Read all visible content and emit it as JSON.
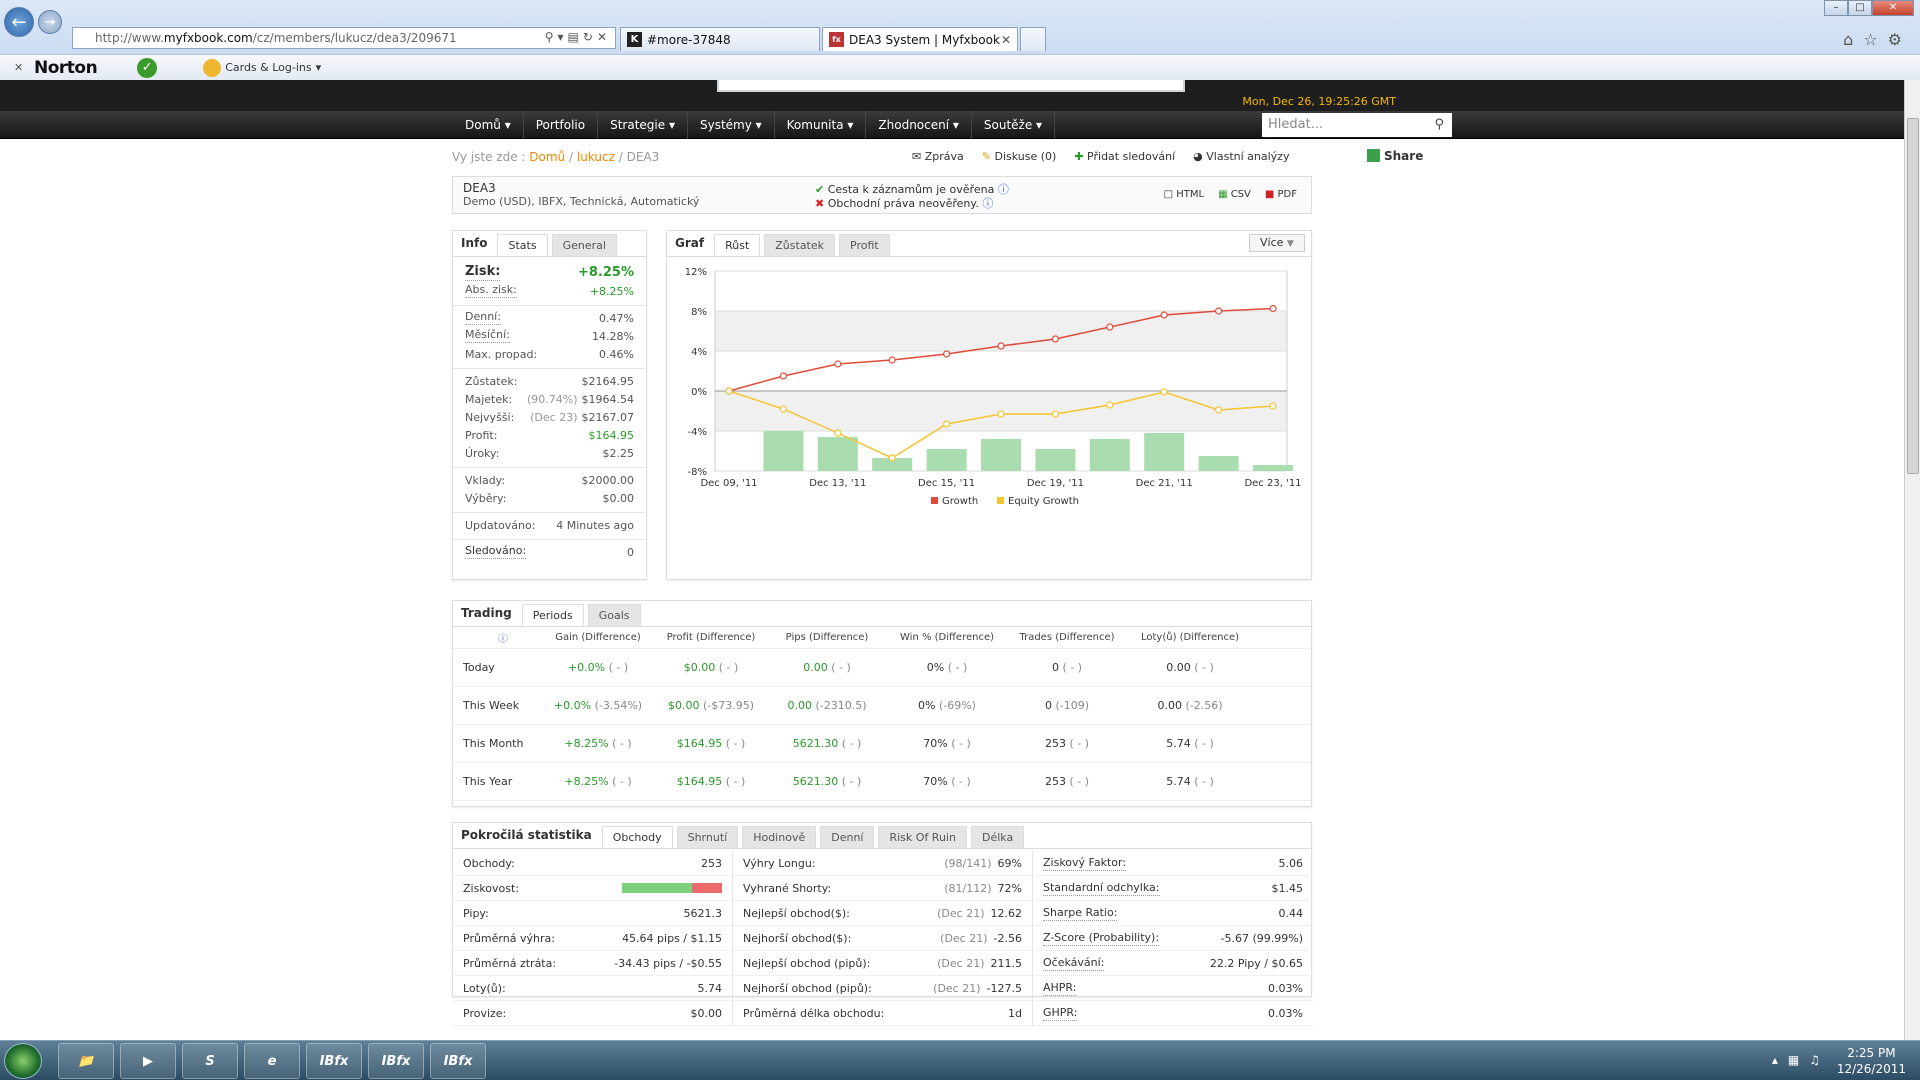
{
  "browser": {
    "url_prefix": "http://www.",
    "url_domain": "myfxbook.com",
    "url_path": "/cz/members/lukucz/dea3/209671",
    "tabs": [
      {
        "label": "#more-37848",
        "icon": "K"
      },
      {
        "label": "DEA3 System | Myfxbook",
        "icon": "fx"
      }
    ],
    "norton": "Norton",
    "cards": "Cards & Log-ins"
  },
  "site": {
    "date": "Mon, Dec 26, 19:25:26 GMT",
    "menu": [
      "Domů ▾",
      "Portfolio",
      "Strategie ▾",
      "Systémy ▾",
      "Komunita ▾",
      "Zhodnocení ▾",
      "Soutěže ▾"
    ],
    "search_placeholder": "Hledat..."
  },
  "breadcrumb": {
    "prefix": "Vy jste zde :",
    "home": "Domů",
    "sep": "/",
    "user": "lukucz",
    "current": "DEA3"
  },
  "actions": {
    "message": "Zpráva",
    "discussion": "Diskuse (0)",
    "follow": "Přidat sledování",
    "analysis": "Vlastní analýzy",
    "share": "Share"
  },
  "system": {
    "name": "DEA3",
    "subtitle": "Demo (USD), IBFX, Technická, Automatický",
    "verified_track": "Cesta k záznamům je ověřena",
    "unverified_privileges": "Obchodní práva neověřeny.",
    "exports": [
      "HTML",
      "CSV",
      "PDF"
    ]
  },
  "info": {
    "tabs": [
      "Info",
      "Stats",
      "General"
    ],
    "gain_label": "Zisk:",
    "gain": "+8.25%",
    "abs_gain_label": "Abs. zisk:",
    "abs_gain": "+8.25%",
    "daily_label": "Denní:",
    "daily": "0.47%",
    "monthly_label": "Měsíční:",
    "monthly": "14.28%",
    "drawdown_label": "Max. propad:",
    "drawdown": "0.46%",
    "balance_label": "Zůstatek:",
    "balance": "$2164.95",
    "equity_label": "Majetek:",
    "equity_pct": "(90.74%)",
    "equity": "$1964.54",
    "highest_label": "Nejvyšší:",
    "highest_date": "(Dec 23)",
    "highest": "$2167.07",
    "profit_label": "Profit:",
    "profit": "$164.95",
    "interest_label": "Úroky:",
    "interest": "$2.25",
    "deposits_label": "Vklady:",
    "deposits": "$2000.00",
    "withdrawals_label": "Výběry:",
    "withdrawals": "$0.00",
    "updated_label": "Updatováno:",
    "updated": "4 Minutes ago",
    "watched_label": "Sledováno:",
    "watched": "0"
  },
  "graph": {
    "tabs": [
      "Graf",
      "Růst",
      "Zůstatek",
      "Profit"
    ],
    "more": "Více"
  },
  "chart_data": {
    "type": "line",
    "x": [
      "Dec 09, '11",
      "Dec 11, '11",
      "Dec 13, '11",
      "Dec 14, '11",
      "Dec 15, '11",
      "Dec 16, '11",
      "Dec 19, '11",
      "Dec 20, '11",
      "Dec 21, '11",
      "Dec 22, '11",
      "Dec 23, '11"
    ],
    "x_tick_labels": [
      "Dec 09, '11",
      "Dec 13, '11",
      "Dec 15, '11",
      "Dec 19, '11",
      "Dec 21, '11",
      "Dec 23, '11"
    ],
    "series": [
      {
        "name": "Growth",
        "color": "#e04a3a",
        "values": [
          0,
          1.5,
          2.7,
          3.1,
          3.7,
          4.5,
          5.2,
          6.4,
          7.6,
          8.0,
          8.25
        ]
      },
      {
        "name": "Equity Growth",
        "color": "#f5c431",
        "values": [
          0,
          -1.8,
          -4.2,
          -6.7,
          -3.3,
          -2.3,
          -2.3,
          -1.4,
          -0.1,
          -1.9,
          -1.5
        ]
      }
    ],
    "bars": {
      "color": "#a9dcae",
      "values": [
        0,
        4.0,
        3.4,
        1.3,
        2.2,
        3.2,
        2.2,
        3.2,
        3.8,
        1.5,
        0.6
      ]
    },
    "yticks": [
      "12%",
      "8%",
      "4%",
      "0%",
      "-4%",
      "-8%"
    ],
    "ylim": [
      -8,
      12
    ],
    "grid": true,
    "legend": "bottom"
  },
  "trading": {
    "tabs": [
      "Trading",
      "Periods",
      "Goals"
    ],
    "headers": [
      "Gain (Difference)",
      "Profit (Difference)",
      "Pips (Difference)",
      "Win % (Difference)",
      "Trades (Difference)",
      "Loty(ů) (Difference)"
    ],
    "rows": [
      {
        "period": "Today",
        "gain": "+0.0%",
        "gain_d": "( - )",
        "profit": "$0.00",
        "profit_d": "( - )",
        "pips": "0.00",
        "pips_d": "( - )",
        "win": "0%",
        "win_d": "( - )",
        "trades": "0",
        "trades_d": "( - )",
        "lots": "0.00",
        "lots_d": "( - )"
      },
      {
        "period": "This Week",
        "gain": "+0.0%",
        "gain_d": "(-3.54%)",
        "profit": "$0.00",
        "profit_d": "(-$73.95)",
        "pips": "0.00",
        "pips_d": "(-2310.5)",
        "win": "0%",
        "win_d": "(-69%)",
        "trades": "0",
        "trades_d": "(-109)",
        "lots": "0.00",
        "lots_d": "(-2.56)"
      },
      {
        "period": "This Month",
        "gain": "+8.25%",
        "gain_d": "( - )",
        "profit": "$164.95",
        "profit_d": "( - )",
        "pips": "5621.30",
        "pips_d": "( - )",
        "win": "70%",
        "win_d": "( - )",
        "trades": "253",
        "trades_d": "( - )",
        "lots": "5.74",
        "lots_d": "( - )"
      },
      {
        "period": "This Year",
        "gain": "+8.25%",
        "gain_d": "( - )",
        "profit": "$164.95",
        "profit_d": "( - )",
        "pips": "5621.30",
        "pips_d": "( - )",
        "win": "70%",
        "win_d": "( - )",
        "trades": "253",
        "trades_d": "( - )",
        "lots": "5.74",
        "lots_d": "( - )"
      }
    ]
  },
  "advanced": {
    "tabs": [
      "Pokročilá statistika",
      "Obchody",
      "Shrnutí",
      "Hodinově",
      "Denní",
      "Risk Of Ruin",
      "Délka"
    ],
    "col1": [
      {
        "label": "Obchody:",
        "value": "253"
      },
      {
        "label": "Ziskovost:",
        "value": ""
      },
      {
        "label": "Pipy:",
        "value": "5621.3"
      },
      {
        "label": "Průměrná výhra:",
        "value": "45.64 pips / $1.15"
      },
      {
        "label": "Průměrná ztráta:",
        "value": "-34.43 pips / -$0.55"
      },
      {
        "label": "Loty(ů):",
        "value": "5.74"
      },
      {
        "label": "Provize:",
        "value": "$0.00"
      }
    ],
    "profitability_win_fraction": 0.7,
    "col2": [
      {
        "label": "Výhry Longu:",
        "muted": "(98/141)",
        "value": "69%"
      },
      {
        "label": "Vyhrané Shorty:",
        "muted": "(81/112)",
        "value": "72%"
      },
      {
        "label": "Nejlepší obchod($):",
        "muted": "(Dec 21)",
        "value": "12.62"
      },
      {
        "label": "Nejhorší obchod($):",
        "muted": "(Dec 21)",
        "value": "-2.56"
      },
      {
        "label": "Nejlepší obchod (pipů):",
        "muted": "(Dec 21)",
        "value": "211.5"
      },
      {
        "label": "Nejhorší obchod (pipů):",
        "muted": "(Dec 21)",
        "value": "-127.5"
      },
      {
        "label": "Průměrná délka obchodu:",
        "muted": "",
        "value": "1d"
      }
    ],
    "col3": [
      {
        "label": "Ziskový Faktor:",
        "value": "5.06"
      },
      {
        "label": "Standardní odchylka:",
        "value": "$1.45"
      },
      {
        "label": "Sharpe Ratio:",
        "value": "0.44"
      },
      {
        "label": "Z-Score (Probability):",
        "value": "-5.67 (99.99%)"
      },
      {
        "label": "Očekávání:",
        "value": "22.2 Pipy / $0.65"
      },
      {
        "label": "AHPR:",
        "value": "0.03%"
      },
      {
        "label": "GHPR:",
        "value": "0.03%"
      }
    ]
  },
  "taskbar": {
    "time": "2:25 PM",
    "date": "12/26/2011",
    "app_label": "IBfx"
  }
}
